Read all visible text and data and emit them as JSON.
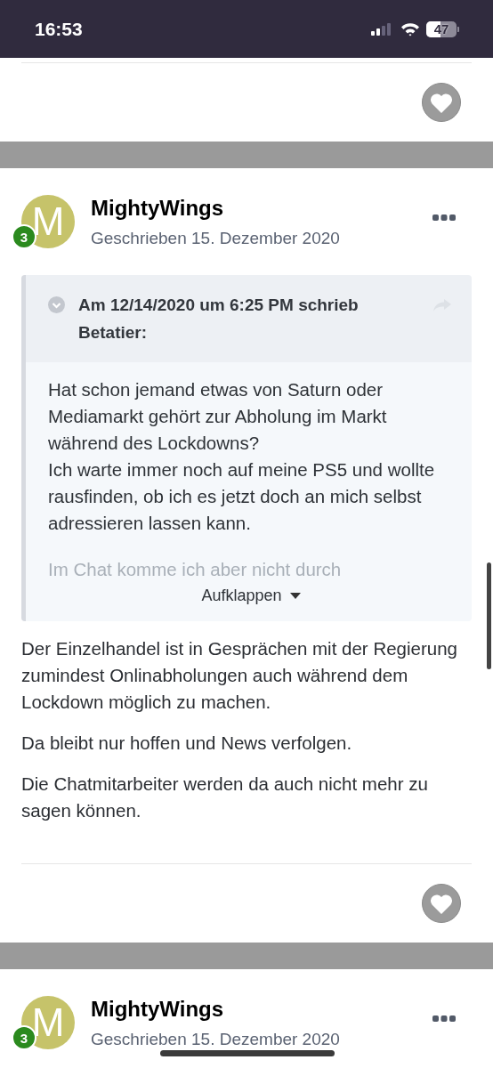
{
  "status_bar": {
    "time": "16:53",
    "battery": "47"
  },
  "previous_post_footer": {
    "liked": false
  },
  "posts": [
    {
      "author": "MightyWings",
      "avatar_letter": "M",
      "rank": "3",
      "date": "Geschrieben 15. Dezember 2020",
      "quote": {
        "header": "Am 12/14/2020 um 6:25 PM schrieb Betatier:",
        "paragraphs": [
          "Hat schon jemand etwas von Saturn oder Mediamarkt gehört zur Abholung im Markt während des Lockdowns?\nIch warte immer noch auf meine PS5 und wollte rausfinden, ob ich es jetzt doch an mich selbst adressieren lassen kann.",
          "Im Chat komme ich aber nicht durch"
        ],
        "expand_label": "Aufklappen"
      },
      "body": [
        "Der Einzelhandel ist in Gesprächen mit der Regierung zumindest Onlinabholungen auch während dem Lockdown möglich zu machen.",
        "Da bleibt nur hoffen und News verfolgen.",
        "Die Chatmitarbeiter werden da auch nicht mehr zu sagen können."
      ],
      "liked": false
    },
    {
      "author": "MightyWings",
      "avatar_letter": "M",
      "rank": "3",
      "date": "Geschrieben 15. Dezember 2020"
    }
  ]
}
